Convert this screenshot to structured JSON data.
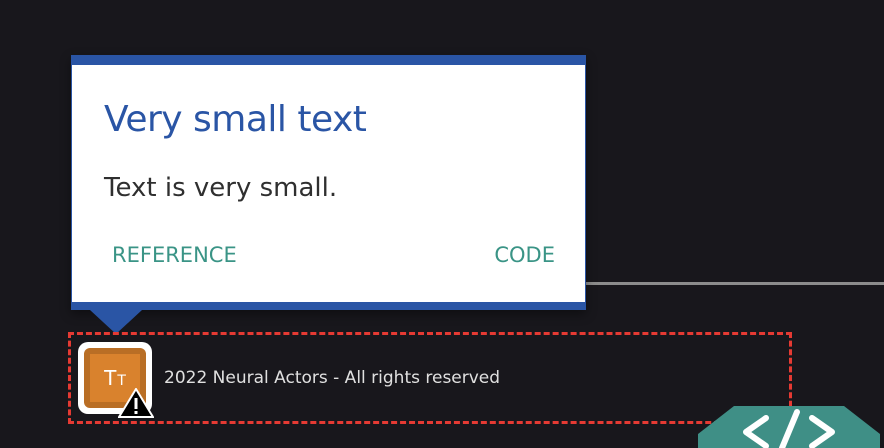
{
  "tooltip": {
    "title": "Very small text",
    "body": "Text is very small.",
    "reference_label": "REFERENCE",
    "code_label": "CODE"
  },
  "footer": {
    "copyright": "2022 Neural Actors - All rights reserved",
    "icon_glyph": "T",
    "icon_glyph_small": "T"
  },
  "icons": {
    "text-size": "text-size-icon",
    "warning": "warning-icon",
    "code-badge": "code-brackets-icon"
  },
  "colors": {
    "background": "#18171c",
    "tooltip_accent": "#2a55a5",
    "link": "#3a9486",
    "highlight_border": "#e53a33",
    "icon_orange": "#d9822d",
    "badge_teal": "#3f8f86"
  }
}
